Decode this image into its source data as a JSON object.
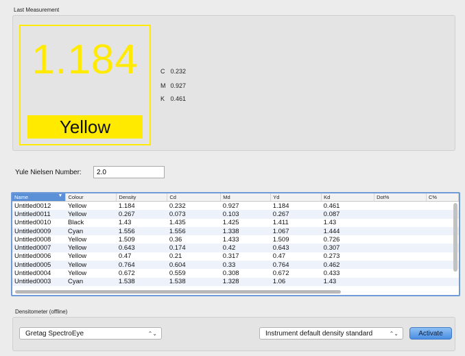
{
  "last_measurement": {
    "label": "Last Measurement",
    "value": "1.184",
    "colour": "Yellow",
    "accent_color": "#ffea00",
    "cmk": [
      {
        "label": "C",
        "value": "0.232"
      },
      {
        "label": "M",
        "value": "0.927"
      },
      {
        "label": "K",
        "value": "0.461"
      }
    ]
  },
  "yule_nielsen": {
    "label": "Yule Nielsen Number:",
    "value": "2.0"
  },
  "table": {
    "headers": [
      "Name",
      "Colour",
      "Density",
      "Cd",
      "Md",
      "Yd",
      "Kd",
      "Dot%",
      "C%"
    ],
    "sort_indicator": "▼",
    "rows": [
      [
        "Untitled0012",
        "Yellow",
        "1.184",
        "0.232",
        "0.927",
        "1.184",
        "0.461"
      ],
      [
        "Untitled0011",
        "Yellow",
        "0.267",
        "0.073",
        "0.103",
        "0.267",
        "0.087"
      ],
      [
        "Untitled0010",
        "Black",
        "1.43",
        "1.435",
        "1.425",
        "1.411",
        "1.43"
      ],
      [
        "Untitled0009",
        "Cyan",
        "1.556",
        "1.556",
        "1.338",
        "1.067",
        "1.444"
      ],
      [
        "Untitled0008",
        "Yellow",
        "1.509",
        "0.36",
        "1.433",
        "1.509",
        "0.726"
      ],
      [
        "Untitled0007",
        "Yellow",
        "0.643",
        "0.174",
        "0.42",
        "0.643",
        "0.307"
      ],
      [
        "Untitled0006",
        "Yellow",
        "0.47",
        "0.21",
        "0.317",
        "0.47",
        "0.273"
      ],
      [
        "Untitled0005",
        "Yellow",
        "0.764",
        "0.604",
        "0.33",
        "0.764",
        "0.462"
      ],
      [
        "Untitled0004",
        "Yellow",
        "0.672",
        "0.559",
        "0.308",
        "0.672",
        "0.433"
      ],
      [
        "Untitled0003",
        "Cyan",
        "1.538",
        "1.538",
        "1.328",
        "1.06",
        "1.43"
      ]
    ]
  },
  "densitometer": {
    "label": "Densitometer (offline)",
    "device": "Gretag SpectroEye",
    "standard": "Instrument default density standard",
    "activate_label": "Activate",
    "arrows": "⌃⌄"
  }
}
